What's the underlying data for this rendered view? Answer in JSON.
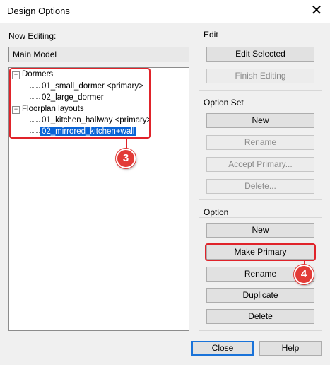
{
  "window": {
    "title": "Design Options"
  },
  "now_editing": {
    "label": "Now Editing:",
    "value": "Main Model"
  },
  "tree": {
    "groups": [
      {
        "label": "Dormers",
        "expander": "−",
        "items": [
          {
            "label": "01_small_dormer  <primary>"
          },
          {
            "label": "02_large_dormer"
          }
        ]
      },
      {
        "label": "Floorplan layouts",
        "expander": "−",
        "items": [
          {
            "label": "01_kitchen_hallway  <primary>"
          },
          {
            "label": "02_mirrored_kitchen+wall",
            "selected": true
          }
        ]
      }
    ]
  },
  "edit": {
    "label": "Edit",
    "edit_selected": "Edit Selected",
    "finish_editing": "Finish Editing"
  },
  "option_set": {
    "label": "Option Set",
    "new": "New",
    "rename": "Rename",
    "accept_primary": "Accept Primary...",
    "delete": "Delete..."
  },
  "option": {
    "label": "Option",
    "new": "New",
    "make_primary": "Make Primary",
    "rename": "Rename",
    "duplicate": "Duplicate",
    "delete": "Delete"
  },
  "footer": {
    "close": "Close",
    "help": "Help"
  },
  "annotations": {
    "tree_callout": "3",
    "make_primary_callout": "4",
    "color": "#e0232a"
  }
}
